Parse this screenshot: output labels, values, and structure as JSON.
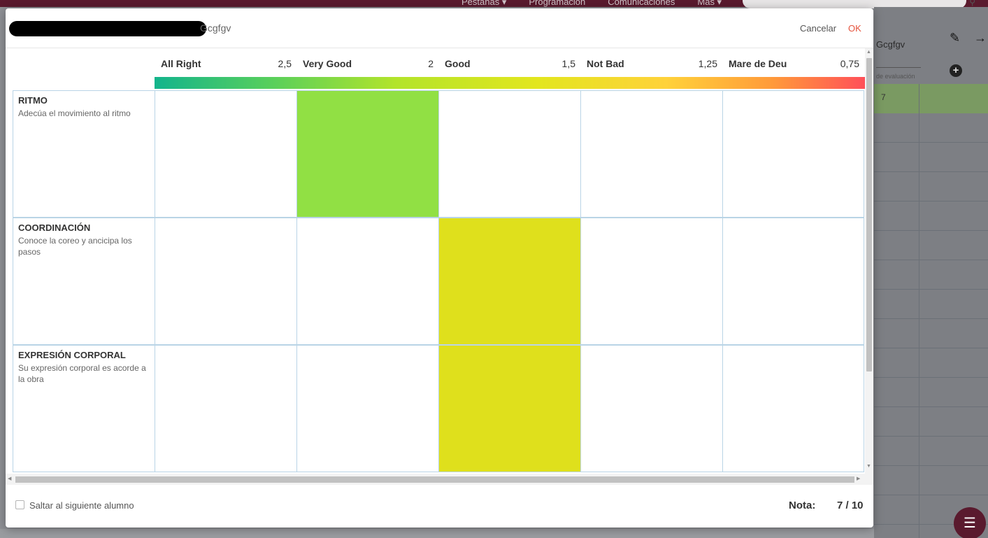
{
  "background": {
    "nav": [
      "Pestañas ▾",
      "Programación",
      "Comunicaciones",
      "Más ▾"
    ],
    "panel_title": "Gcgfgv",
    "column_header": "de evaluación",
    "first_row_value": "7"
  },
  "dialog": {
    "title": "Gcgfgv",
    "cancel_label": "Cancelar",
    "ok_label": "OK"
  },
  "levels": [
    {
      "name": "All Right",
      "score": "2,5"
    },
    {
      "name": "Very Good",
      "score": "2"
    },
    {
      "name": "Good",
      "score": "1,5"
    },
    {
      "name": "Not Bad",
      "score": "1,25"
    },
    {
      "name": "Mare de Deu",
      "score": "0,75"
    }
  ],
  "criteria": [
    {
      "name": "RITMO",
      "description": "Adecúa el movimiento al ritmo",
      "selected_level": 1,
      "color": "#91e044"
    },
    {
      "name": "COORDINACIÓN",
      "description": "Conoce la coreo y ancicipa los pasos",
      "selected_level": 2,
      "color": "#dfe01c"
    },
    {
      "name": "EXPRESIÓN CORPORAL",
      "description": "Su expresión corporal es acorde a la obra",
      "selected_level": 2,
      "color": "#dfe01c"
    }
  ],
  "footer": {
    "skip_label": "Saltar al siguiente alumno",
    "skip_checked": false,
    "grade_label": "Nota:",
    "grade_value": "7 / 10"
  },
  "colors": {
    "accent_ok": "#e5533d",
    "app_bar": "#5a1a2e",
    "grid_border": "#b9d4e6"
  }
}
